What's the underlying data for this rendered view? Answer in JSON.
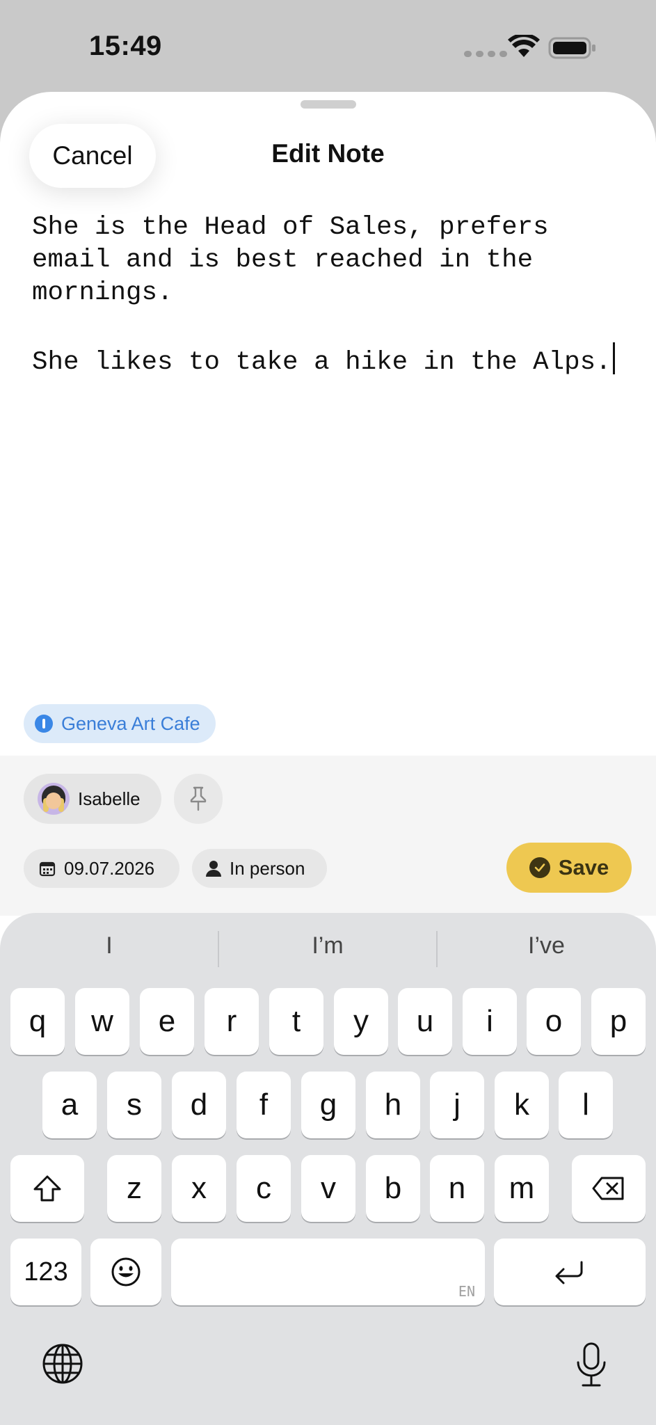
{
  "status_bar": {
    "time": "15:49"
  },
  "sheet": {
    "cancel_label": "Cancel",
    "title": "Edit Note"
  },
  "note": {
    "text": "She is the Head of Sales, prefers\nemail and is best reached in the\nmornings.\n\nShe likes to take a hike in the Alps."
  },
  "location": {
    "label": "Geneva Art Cafe",
    "icon": "location-pin-icon",
    "color": "#3a7ed8"
  },
  "person": {
    "name": "Isabelle",
    "icon": "avatar"
  },
  "meta": {
    "date": "09.07.2026",
    "date_icon": "calendar-icon",
    "mode": "In person",
    "mode_icon": "person-icon"
  },
  "save": {
    "label": "Save",
    "color": "#eec851"
  },
  "keyboard": {
    "suggestions": [
      "I",
      "I’m",
      "I’ve"
    ],
    "row1": [
      "q",
      "w",
      "e",
      "r",
      "t",
      "y",
      "u",
      "i",
      "o",
      "p"
    ],
    "row2": [
      "a",
      "s",
      "d",
      "f",
      "g",
      "h",
      "j",
      "k",
      "l"
    ],
    "row3": [
      "z",
      "x",
      "c",
      "v",
      "b",
      "n",
      "m"
    ],
    "numbers_label": "123",
    "space_language": "EN"
  }
}
